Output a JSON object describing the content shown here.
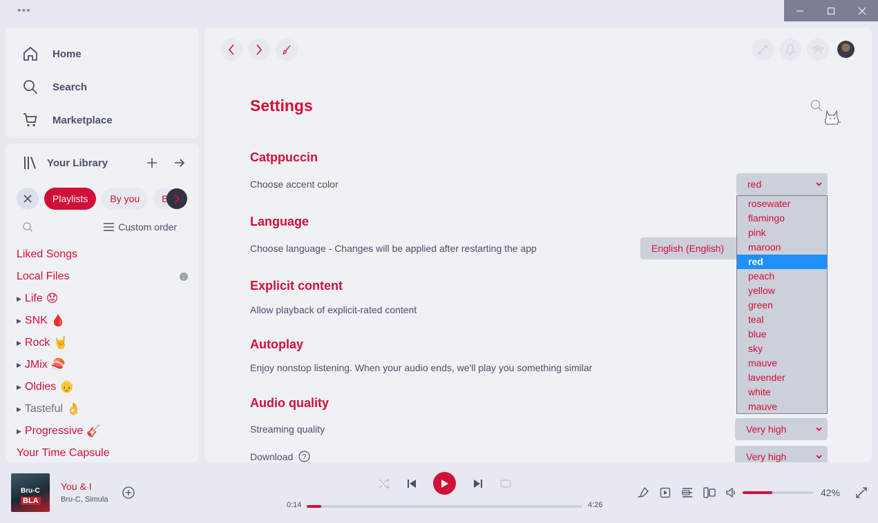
{
  "window": {
    "menu_dots": "•••",
    "controls": [
      "minimize-icon",
      "maximize-icon",
      "close-icon"
    ]
  },
  "nav": {
    "items": [
      {
        "label": "Home",
        "icon": "home-icon"
      },
      {
        "label": "Search",
        "icon": "search-icon"
      },
      {
        "label": "Marketplace",
        "icon": "cart-icon"
      }
    ]
  },
  "library": {
    "title": "Your Library",
    "chips": [
      "Playlists",
      "By you",
      "B"
    ],
    "sort_label": "Custom order",
    "items": [
      {
        "label": "Liked Songs",
        "folder": false,
        "emoji": ""
      },
      {
        "label": "Local Files",
        "folder": false,
        "emoji": ""
      },
      {
        "label": "Life",
        "folder": true,
        "emoji": "😟"
      },
      {
        "label": "SNK",
        "folder": true,
        "emoji": "🩸"
      },
      {
        "label": "Rock",
        "folder": true,
        "emoji": "🤘"
      },
      {
        "label": "JMix",
        "folder": true,
        "emoji": "🍣"
      },
      {
        "label": "Oldies",
        "folder": true,
        "emoji": "👴"
      },
      {
        "label": "Tasteful",
        "folder": true,
        "emoji": "👌"
      },
      {
        "label": "Progressive",
        "folder": true,
        "emoji": "🎸"
      },
      {
        "label": "Your Time Capsule",
        "folder": false,
        "emoji": ""
      }
    ]
  },
  "settings": {
    "title": "Settings",
    "sections": {
      "catppuccin": {
        "title": "Catppuccin",
        "label": "Choose accent color",
        "value": "red"
      },
      "language": {
        "title": "Language",
        "label": "Choose language - Changes will be applied after restarting the app",
        "value": "English (English)"
      },
      "explicit": {
        "title": "Explicit content",
        "label": "Allow playback of explicit-rated content"
      },
      "autoplay": {
        "title": "Autoplay",
        "label": "Enjoy nonstop listening. When your audio ends, we'll play you something similar"
      },
      "audio": {
        "title": "Audio quality",
        "streaming_label": "Streaming quality",
        "streaming_value": "Very high",
        "download_label": "Download",
        "download_value": "Very high"
      }
    },
    "accent_options": [
      "rosewater",
      "flamingo",
      "pink",
      "maroon",
      "red",
      "peach",
      "yellow",
      "green",
      "teal",
      "blue",
      "sky",
      "mauve",
      "lavender",
      "white",
      "mauve"
    ],
    "accent_selected_index": 4
  },
  "player": {
    "title": "You & I",
    "artist": "Bru-C, Simula",
    "cover_text_top": "Bru-C",
    "cover_text_bottom": "BLA",
    "elapsed": "0:14",
    "duration": "4:26",
    "progress_fraction": 0.053,
    "volume": "42%",
    "volume_fraction": 0.42
  },
  "colors": {
    "accent": "#d20f39",
    "base": "#eff1f5",
    "mantle": "#e6e9ef",
    "surface": "#ccd0da",
    "text": "#4c4f69",
    "highlight": "#1e90ff"
  }
}
